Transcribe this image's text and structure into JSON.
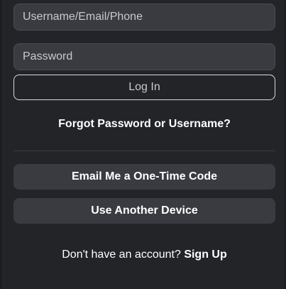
{
  "login": {
    "username_placeholder": "Username/Email/Phone",
    "password_placeholder": "Password",
    "login_label": "Log In",
    "forgot_label": "Forgot Password or Username?",
    "email_code_label": "Email Me a One-Time Code",
    "another_device_label": "Use Another Device",
    "signup_prompt": "Don't have an account?",
    "signup_link": "Sign Up"
  },
  "colors": {
    "background": "#232428",
    "field_bg": "#393b40",
    "text": "#ffffff"
  }
}
